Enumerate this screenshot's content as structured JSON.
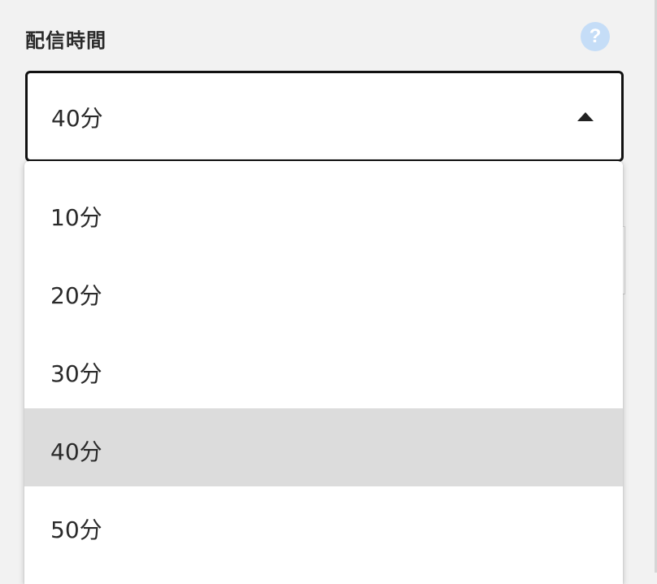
{
  "field": {
    "label": "配信時間",
    "help_icon": "?",
    "selected_value": "40分"
  },
  "dropdown": {
    "options": [
      {
        "label": "10分"
      },
      {
        "label": "20分"
      },
      {
        "label": "30分"
      },
      {
        "label": "40分"
      },
      {
        "label": "50分"
      }
    ],
    "selected_index": 3
  },
  "icons": {
    "help": "question-circle-icon",
    "toggle": "caret-up-icon"
  },
  "colors": {
    "help_icon_bg": "#c5ddf7",
    "selected_option_bg": "#dcdcdc",
    "border": "#111111"
  }
}
